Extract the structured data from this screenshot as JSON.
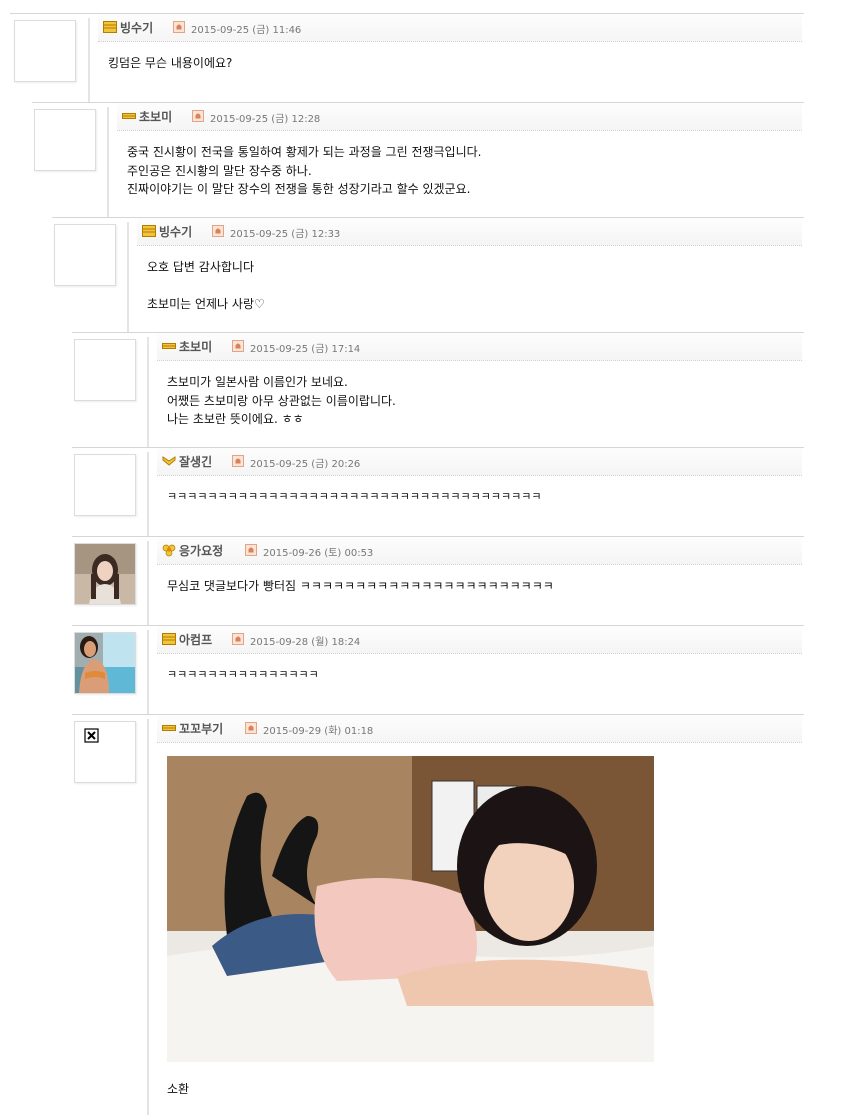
{
  "comments": [
    {
      "nick": "빙수기",
      "level": "lines",
      "date": "2015-09-25 (금) 11:46",
      "lines": [
        "킹덤은 무슨 내용이에요?"
      ]
    },
    {
      "nick": "초보미",
      "level": "bar",
      "date": "2015-09-25 (금) 12:28",
      "lines": [
        "중국 진시황이 전국을 통일하여 황제가 되는 과정을 그린 전쟁극입니다.",
        "주인공은 진시황의 말단 장수중 하나.",
        "진짜이야기는 이 말단 장수의 전쟁을 통한 성장기라고 할수 있겠군요."
      ]
    },
    {
      "nick": "빙수기",
      "level": "lines",
      "date": "2015-09-25 (금) 12:33",
      "lines": [
        "오호 답변 감사합니다",
        "",
        "초보미는 언제나 사랑♡"
      ]
    },
    {
      "nick": "초보미",
      "level": "bar",
      "date": "2015-09-25 (금) 17:14",
      "lines": [
        "츠보미가 일본사람 이름인가 보네요.",
        "어쨌든 츠보미랑 아무 상관없는 이름이랍니다.",
        "나는 초보란 뜻이에요. ㅎㅎ"
      ]
    },
    {
      "nick": "잘생긴",
      "level": "chevron",
      "date": "2015-09-25 (금) 20:26",
      "lines": [
        "ㅋㅋㅋㅋㅋㅋㅋㅋㅋㅋㅋㅋㅋㅋㅋㅋㅋㅋㅋㅋㅋㅋㅋㅋㅋㅋㅋㅋㅋㅋㅋㅋㅋㅋㅋㅋㅋ"
      ]
    },
    {
      "nick": "응가요정",
      "level": "flower",
      "date": "2015-09-26 (토) 00:53",
      "lines": [
        "무심코 댓글보다가 빵터짐 ㅋㅋㅋㅋㅋㅋㅋㅋㅋㅋㅋㅋㅋㅋㅋㅋㅋㅋㅋㅋㅋㅋㅋ"
      ]
    },
    {
      "nick": "아컴프",
      "level": "lines",
      "date": "2015-09-28 (월) 18:24",
      "lines": [
        "ㅋㅋㅋㅋㅋㅋㅋㅋㅋㅋㅋㅋㅋㅋㅋ"
      ]
    },
    {
      "nick": "꼬꼬부기",
      "level": "bar",
      "date": "2015-09-29 (화) 01:18",
      "lines": [
        "소환"
      ]
    }
  ],
  "colors": {
    "accent": "#e0a000",
    "level_fill": "#f3c43a",
    "level_stroke": "#b07d00",
    "border": "#d6d6d6"
  },
  "icons": {
    "level_lines": "level-lines-icon",
    "level_bar": "level-bar-icon",
    "level_chevron": "level-chevron-icon",
    "level_flower": "level-flower-icon",
    "bell": "alarm-icon",
    "broken_image": "broken-image-icon"
  }
}
